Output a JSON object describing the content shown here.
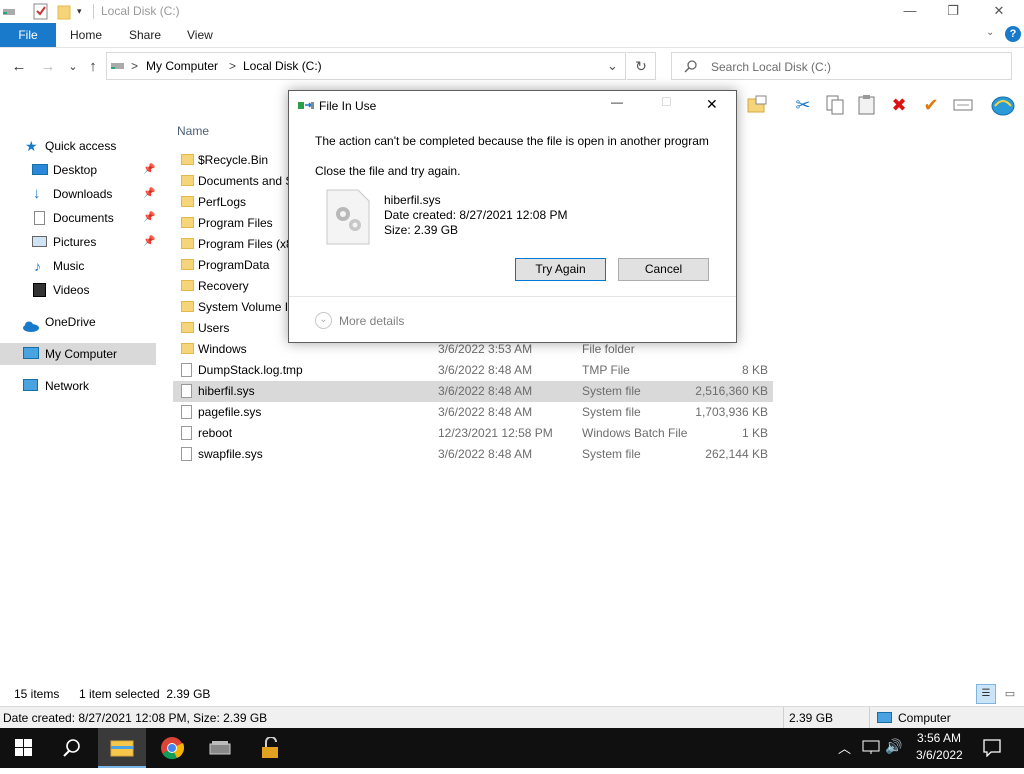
{
  "window": {
    "title": "Local Disk (C:)",
    "controls": {
      "minimize": "—",
      "maximize": "❐",
      "close": "✕"
    }
  },
  "ribbon": {
    "file_tab": "File",
    "tabs": [
      "Home",
      "Share",
      "View"
    ],
    "help": "?"
  },
  "nav": {
    "back": "←",
    "forward": "→",
    "recent": "⌄",
    "up": "↑",
    "breadcrumb": [
      "My Computer",
      "Local Disk (C:)"
    ],
    "separator": ">",
    "dropdown": "⌄",
    "refresh": "↻"
  },
  "search": {
    "placeholder": "Search Local Disk (C:)"
  },
  "sidebar": {
    "items": [
      {
        "label": "Quick access",
        "icon": "star-icon"
      },
      {
        "label": "Desktop",
        "icon": "desktop-icon",
        "pinned": true
      },
      {
        "label": "Downloads",
        "icon": "download-icon",
        "pinned": true
      },
      {
        "label": "Documents",
        "icon": "documents-icon",
        "pinned": true
      },
      {
        "label": "Pictures",
        "icon": "pictures-icon",
        "pinned": true
      },
      {
        "label": "Music",
        "icon": "music-icon"
      },
      {
        "label": "Videos",
        "icon": "videos-icon"
      },
      {
        "label": "OneDrive",
        "icon": "cloud-icon"
      },
      {
        "label": "My Computer",
        "icon": "computer-icon",
        "selected": true
      },
      {
        "label": "Network",
        "icon": "network-icon"
      }
    ]
  },
  "list": {
    "header_name": "Name",
    "rows": [
      {
        "name": "$Recycle.Bin",
        "date": "",
        "type": "",
        "size": "",
        "kind": "folder"
      },
      {
        "name": "Documents and S",
        "date": "",
        "type": "",
        "size": "",
        "kind": "folder"
      },
      {
        "name": "PerfLogs",
        "date": "",
        "type": "",
        "size": "",
        "kind": "folder"
      },
      {
        "name": "Program Files",
        "date": "",
        "type": "",
        "size": "",
        "kind": "folder"
      },
      {
        "name": "Program Files (x8",
        "date": "",
        "type": "",
        "size": "",
        "kind": "folder"
      },
      {
        "name": "ProgramData",
        "date": "",
        "type": "",
        "size": "",
        "kind": "folder"
      },
      {
        "name": "Recovery",
        "date": "",
        "type": "",
        "size": "",
        "kind": "folder"
      },
      {
        "name": "System Volume In",
        "date": "",
        "type": "",
        "size": "",
        "kind": "folder"
      },
      {
        "name": "Users",
        "date": "",
        "type": "",
        "size": "",
        "kind": "folder"
      },
      {
        "name": "Windows",
        "date": "3/6/2022 3:53 AM",
        "type": "File folder",
        "size": "",
        "kind": "folder"
      },
      {
        "name": "DumpStack.log.tmp",
        "date": "3/6/2022 8:48 AM",
        "type": "TMP File",
        "size": "8 KB",
        "kind": "file"
      },
      {
        "name": "hiberfil.sys",
        "date": "3/6/2022 8:48 AM",
        "type": "System file",
        "size": "2,516,360 KB",
        "kind": "file",
        "selected": true
      },
      {
        "name": "pagefile.sys",
        "date": "3/6/2022 8:48 AM",
        "type": "System file",
        "size": "1,703,936 KB",
        "kind": "file"
      },
      {
        "name": "reboot",
        "date": "12/23/2021 12:58 PM",
        "type": "Windows Batch File",
        "size": "1 KB",
        "kind": "file"
      },
      {
        "name": "swapfile.sys",
        "date": "3/6/2022 8:48 AM",
        "type": "System file",
        "size": "262,144 KB",
        "kind": "file"
      }
    ]
  },
  "status": {
    "items": "15 items",
    "selected": "1 item selected  2.39 GB",
    "details": "Date created: 8/27/2021 12:08 PM, Size: 2.39 GB",
    "size": "2.39 GB",
    "location": "Computer"
  },
  "dialog": {
    "title": "File In Use",
    "message": "The action can't be completed because the file is open in another program",
    "instruction": "Close the file and try again.",
    "file_name": "hiberfil.sys",
    "file_created": "Date created: 8/27/2021 12:08 PM",
    "file_size": "Size: 2.39 GB",
    "try_again": "Try Again",
    "cancel": "Cancel",
    "more_details": "More details",
    "controls": {
      "minimize": "—",
      "maximize": "☐",
      "close": "✕"
    }
  },
  "taskbar": {
    "time": "3:56 AM",
    "date": "3/6/2022"
  },
  "colors": {
    "accent": "#1979ca",
    "selection": "#d9d9d9",
    "taskbar": "#101010"
  }
}
